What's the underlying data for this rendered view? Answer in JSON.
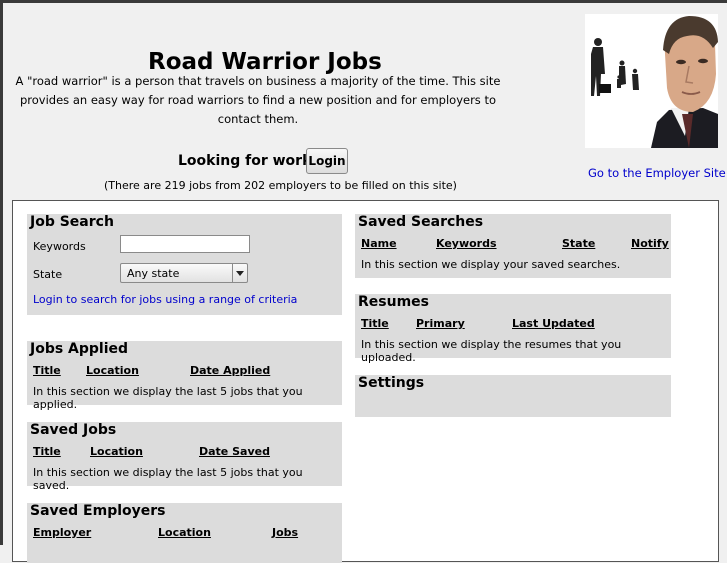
{
  "header": {
    "title": "Road Warrior Jobs",
    "description": "A \"road warrior\" is a person that travels on business a majority of the time. This site provides an easy way for road warriors to find a new position and for employers to contact them.",
    "employer_link": "Go to the Employer Site",
    "looking_label": "Looking for work?",
    "login_button": "Login",
    "job_count": "(There are 219 jobs from 202 employers to be filled on this site)"
  },
  "job_search": {
    "title": "Job Search",
    "keywords_label": "Keywords",
    "keywords_value": "",
    "state_label": "State",
    "state_value": "Any state",
    "criteria_link": "Login to search for jobs using a range of criteria"
  },
  "jobs_applied": {
    "title": "Jobs Applied",
    "columns": [
      "Title",
      "Location",
      "Date Applied"
    ],
    "message": "In this section we display the last 5 jobs that you applied."
  },
  "saved_jobs": {
    "title": "Saved Jobs",
    "columns": [
      "Title",
      "Location",
      "Date Saved"
    ],
    "message": "In this section we display the last 5 jobs that you saved."
  },
  "saved_employers": {
    "title": "Saved Employers",
    "columns": [
      "Employer",
      "Location",
      "Jobs"
    ]
  },
  "saved_searches": {
    "title": "Saved Searches",
    "columns": [
      "Name",
      "Keywords",
      "State",
      "Notify"
    ],
    "message": "In this section we display your saved searches."
  },
  "resumes": {
    "title": "Resumes",
    "columns": [
      "Title",
      "Primary",
      "Last Updated"
    ],
    "message": "In this section we display the resumes that you uploaded."
  },
  "settings": {
    "title": "Settings"
  },
  "colors": {
    "link": "#0000cc",
    "panel_bg": "#dcdcdc",
    "page_bg": "#f0f0f0"
  }
}
